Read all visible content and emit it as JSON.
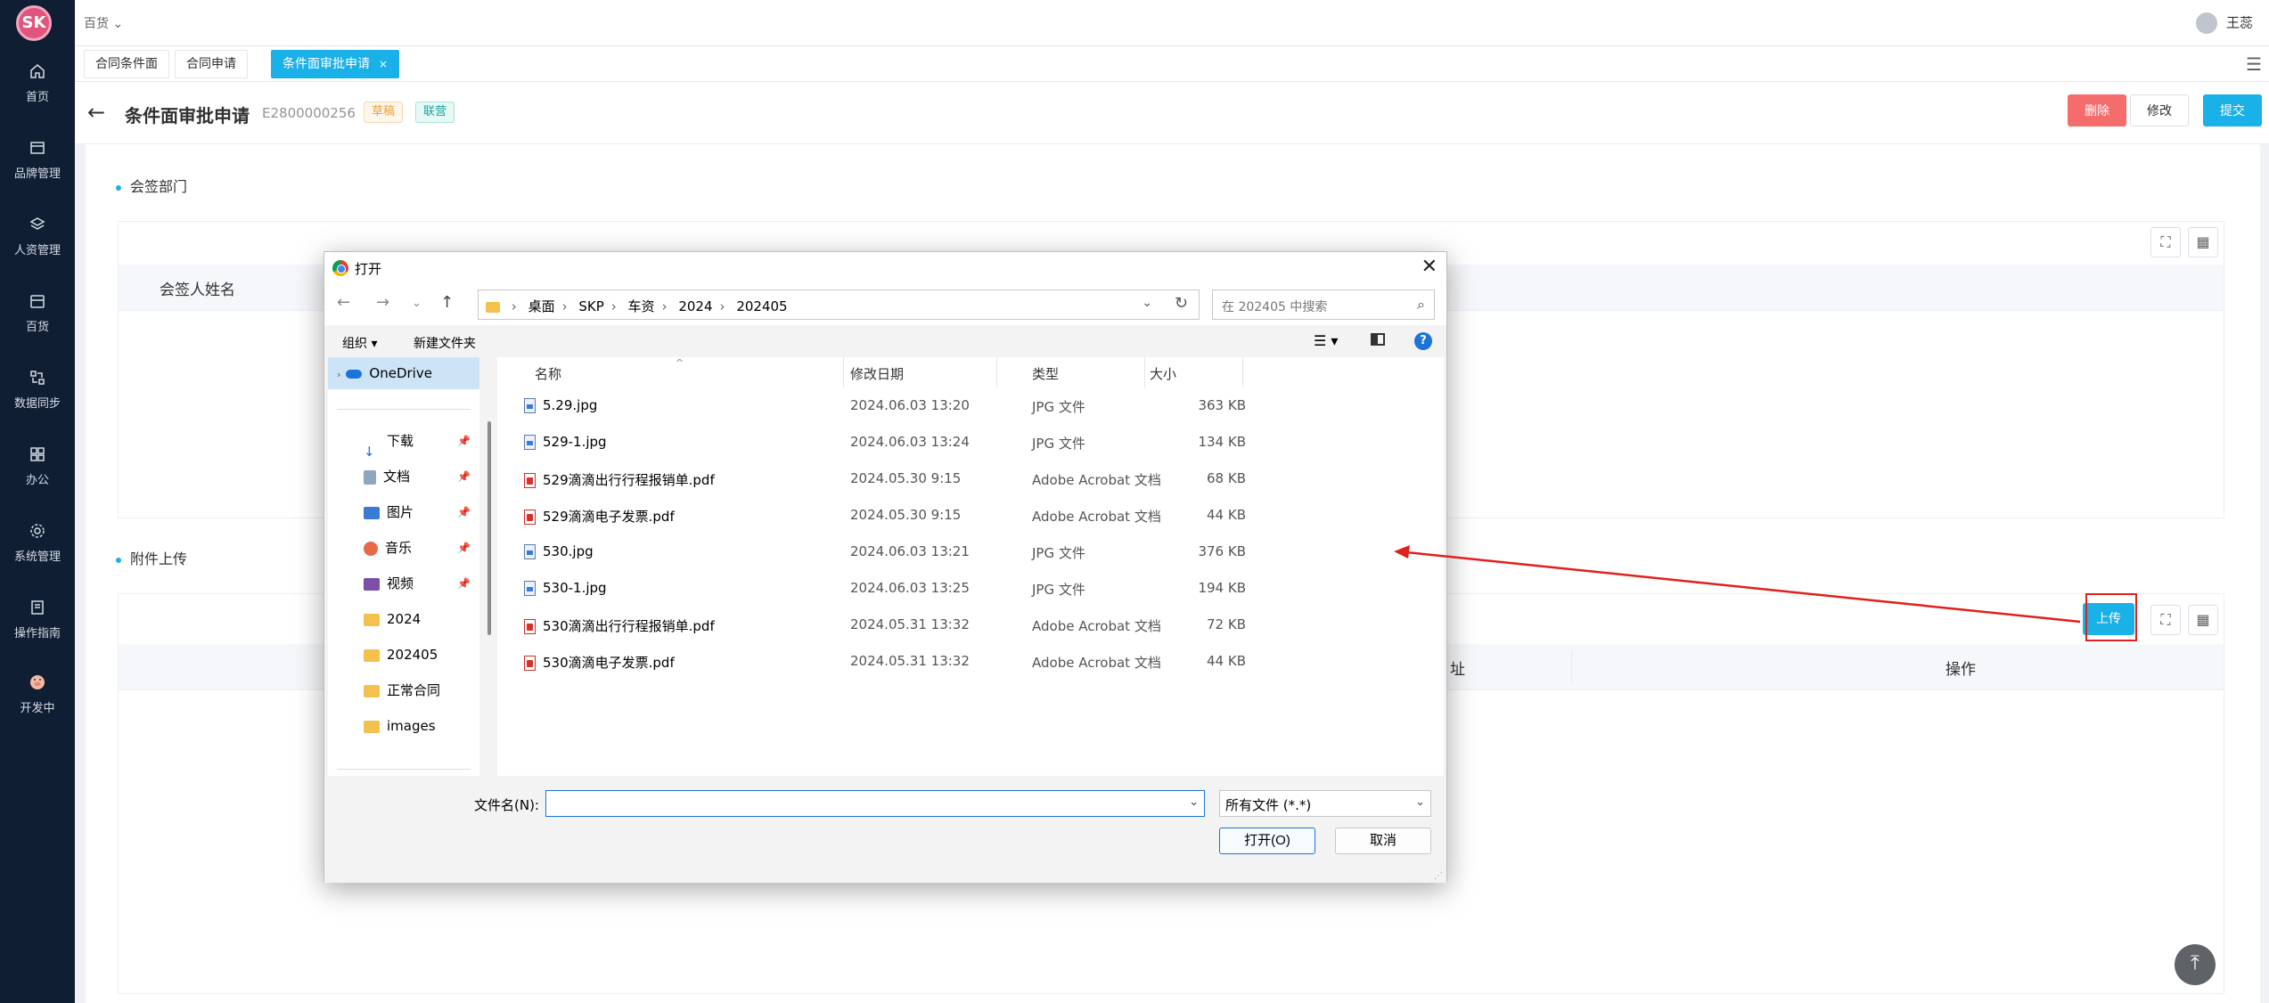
{
  "sidebar": {
    "logo_text": "SK",
    "items": [
      {
        "label": "首页",
        "icon": "home-icon"
      },
      {
        "label": "品牌管理",
        "icon": "brand-icon"
      },
      {
        "label": "人资管理",
        "icon": "layers-icon"
      },
      {
        "label": "百货",
        "icon": "store-icon"
      },
      {
        "label": "数据同步",
        "icon": "sync-icon"
      },
      {
        "label": "办公",
        "icon": "grid-icon"
      },
      {
        "label": "系统管理",
        "icon": "gear-icon"
      },
      {
        "label": "操作指南",
        "icon": "book-icon"
      },
      {
        "label": "开发中",
        "icon": "pig-icon"
      }
    ]
  },
  "topbar": {
    "crumb": "百货 ⌄",
    "user": "王蕊"
  },
  "tabs": [
    {
      "label": "合同条件面"
    },
    {
      "label": "合同申请"
    },
    {
      "label": "条件面审批申请",
      "close": "×"
    }
  ],
  "header": {
    "title": "条件面审批申请",
    "code": "E2800000256",
    "tag_draft": "草稿",
    "tag_joint": "联营",
    "btn_delete": "删除",
    "btn_edit": "修改",
    "btn_submit": "提交"
  },
  "sections": {
    "cosign": {
      "title": "会签部门",
      "col_name": "会签人姓名"
    },
    "attachments": {
      "title": "附件上传",
      "upload": "上传",
      "col_addr": "址",
      "col_op": "操作"
    }
  },
  "dialog": {
    "title": "打开",
    "path": [
      "桌面",
      "SKP",
      "车资",
      "2024",
      "202405"
    ],
    "search_placeholder": "在 202405 中搜索",
    "organize": "组织 ▾",
    "new_folder": "新建文件夹",
    "nav": [
      {
        "label": "OneDrive",
        "type": "cloud"
      },
      {
        "label": "下载",
        "type": "download",
        "pinned": true
      },
      {
        "label": "文档",
        "type": "doc",
        "pinned": true
      },
      {
        "label": "图片",
        "type": "pic",
        "pinned": true
      },
      {
        "label": "音乐",
        "type": "music",
        "pinned": true
      },
      {
        "label": "视频",
        "type": "video",
        "pinned": true
      },
      {
        "label": "2024",
        "type": "folder"
      },
      {
        "label": "202405",
        "type": "folder"
      },
      {
        "label": "正常合同",
        "type": "folder"
      },
      {
        "label": "images",
        "type": "folder"
      }
    ],
    "columns": {
      "name": "名称",
      "date": "修改日期",
      "type": "类型",
      "size": "大小"
    },
    "files": [
      {
        "name": "5.29.jpg",
        "date": "2024.06.03 13:20",
        "type": "JPG 文件",
        "size": "363 KB",
        "kind": "jpg"
      },
      {
        "name": "529-1.jpg",
        "date": "2024.06.03 13:24",
        "type": "JPG 文件",
        "size": "134 KB",
        "kind": "jpg"
      },
      {
        "name": "529滴滴出行行程报销单.pdf",
        "date": "2024.05.30 9:15",
        "type": "Adobe Acrobat 文档",
        "size": "68 KB",
        "kind": "pdf"
      },
      {
        "name": "529滴滴电子发票.pdf",
        "date": "2024.05.30 9:15",
        "type": "Adobe Acrobat 文档",
        "size": "44 KB",
        "kind": "pdf"
      },
      {
        "name": "530.jpg",
        "date": "2024.06.03 13:21",
        "type": "JPG 文件",
        "size": "376 KB",
        "kind": "jpg"
      },
      {
        "name": "530-1.jpg",
        "date": "2024.06.03 13:25",
        "type": "JPG 文件",
        "size": "194 KB",
        "kind": "jpg"
      },
      {
        "name": "530滴滴出行行程报销单.pdf",
        "date": "2024.05.31 13:32",
        "type": "Adobe Acrobat 文档",
        "size": "72 KB",
        "kind": "pdf"
      },
      {
        "name": "530滴滴电子发票.pdf",
        "date": "2024.05.31 13:32",
        "type": "Adobe Acrobat 文档",
        "size": "44 KB",
        "kind": "pdf"
      }
    ],
    "filename_label": "文件名(N):",
    "filename_value": "",
    "filetype": "所有文件 (*.*)",
    "btn_open": "打开(O)",
    "btn_cancel": "取消"
  },
  "colors": {
    "accent": "#1ab0e8",
    "danger": "#f56c6c",
    "sidebar": "#0f1e33",
    "annotation": "#e0201e"
  }
}
